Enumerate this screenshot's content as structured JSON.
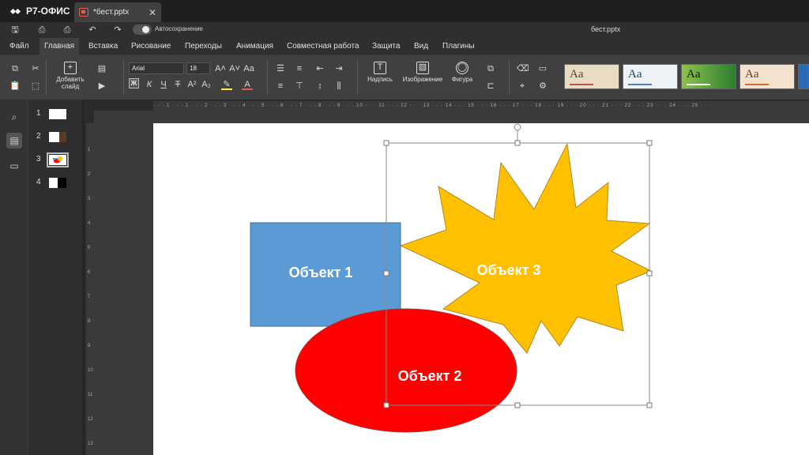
{
  "app": {
    "name": "Р7-ОФИС"
  },
  "tab": {
    "title": "*бест.pptx",
    "close": "✕"
  },
  "quickbar": {
    "autosave_label": "Автосохранение",
    "filename": "бест.pptx"
  },
  "menu": {
    "items": [
      "Файл",
      "Главная",
      "Вставка",
      "Рисование",
      "Переходы",
      "Анимация",
      "Совместная работа",
      "Защита",
      "Вид",
      "Плагины"
    ],
    "active": "Главная"
  },
  "ribbon": {
    "add_slide": "Добавить слайд",
    "font_name": "Arial",
    "font_size": "18",
    "bold": "Ж",
    "italic": "К",
    "underline": "Ч",
    "strike": "Т",
    "caption": "Надпись",
    "image": "Изображение",
    "shape": "Фигура",
    "theme_sample": "Aa"
  },
  "thumbnails": {
    "numbers": [
      "1",
      "2",
      "3",
      "4"
    ],
    "selected": "3"
  },
  "slide": {
    "objects": {
      "rect": "Объект 1",
      "ellipse": "Объект 2",
      "star": "Объект 3"
    }
  },
  "colors": {
    "rect": "#5b9bd5",
    "ellipse": "#ff0000",
    "star": "#ffc000",
    "accent_theme": "#e05a5a"
  }
}
